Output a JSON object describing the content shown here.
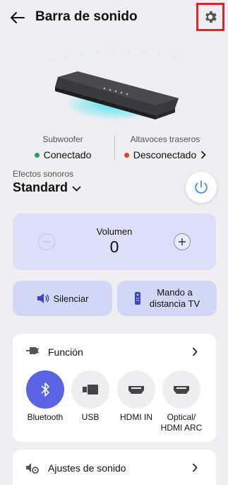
{
  "header": {
    "title": "Barra de sonido",
    "icons": {
      "back": "arrow-left-icon",
      "settings": "gear-icon"
    },
    "settings_highlight_color": "#e0242b"
  },
  "speakers": {
    "subwoofer": {
      "label": "Subwoofer",
      "status": "Conectado",
      "status_color": "#21a366"
    },
    "rear": {
      "label": "Altavoces traseros",
      "status": "Desconectado",
      "status_color": "#e5421c"
    }
  },
  "effects": {
    "label": "Efectos sonoros",
    "value": "Standard"
  },
  "volume": {
    "label": "Volumen",
    "value": "0"
  },
  "actions": {
    "mute": "Silenciar",
    "remote_line1": "Mando a",
    "remote_line2": "distancia TV"
  },
  "function": {
    "title": "Función",
    "items": [
      {
        "label": "Bluetooth",
        "icon": "bluetooth-icon",
        "active": true
      },
      {
        "label": "USB",
        "icon": "usb-icon",
        "active": false
      },
      {
        "label": "HDMI IN",
        "icon": "hdmi-icon",
        "active": false
      },
      {
        "label_line1": "Optical/",
        "label_line2": "HDMI ARC",
        "icon": "hdmi-icon",
        "active": false
      }
    ]
  },
  "sound_settings": {
    "title": "Ajustes de sonido"
  },
  "colors": {
    "accent": "#5a63e3",
    "volume_card": "#dcdff7",
    "action_button": "#d2d7f7",
    "power_icon": "#3f8fd6"
  }
}
